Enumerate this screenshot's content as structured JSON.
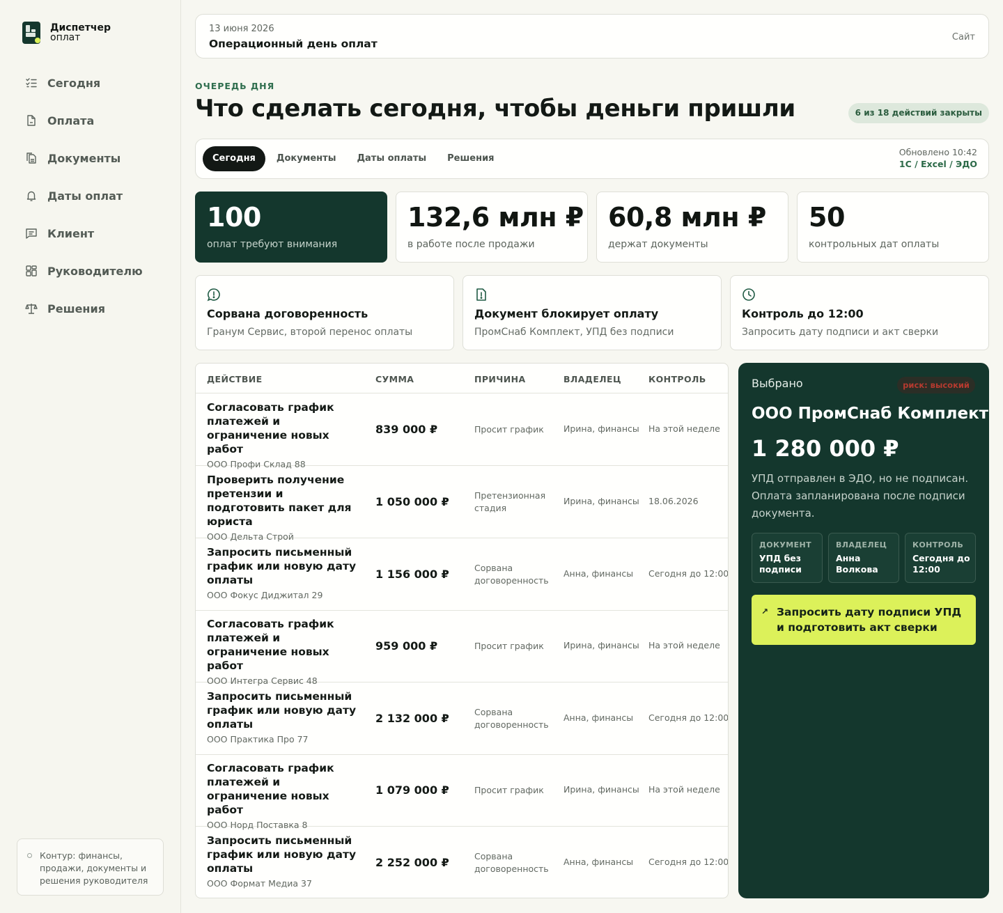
{
  "brand": {
    "name": "Диспетчер",
    "sub": "оплат"
  },
  "sidebar": {
    "items": [
      {
        "label": "Сегодня",
        "icon": "checklist-icon"
      },
      {
        "label": "Оплата",
        "icon": "document-icon"
      },
      {
        "label": "Документы",
        "icon": "documents-icon"
      },
      {
        "label": "Даты оплат",
        "icon": "bell-icon"
      },
      {
        "label": "Клиент",
        "icon": "message-icon"
      },
      {
        "label": "Руководителю",
        "icon": "dashboard-icon"
      },
      {
        "label": "Решения",
        "icon": "scales-icon"
      }
    ],
    "note": "Контур: финансы, продажи, документы и решения руководителя"
  },
  "topbar": {
    "date": "13 июня 2026",
    "title": "Операционный день оплат",
    "site": "Сайт"
  },
  "header": {
    "eyebrow": "ОЧЕРЕДЬ ДНЯ",
    "title": "Что сделать сегодня, чтобы деньги пришли",
    "progress": "6 из 18 действий закрыты"
  },
  "tabs": {
    "items": [
      "Сегодня",
      "Документы",
      "Даты оплаты",
      "Решения"
    ],
    "active": 0,
    "updated": "Обновлено 10:42",
    "sources": "1С / Excel / ЭДО"
  },
  "kpis": [
    {
      "value": "100",
      "label": "оплат требуют внимания"
    },
    {
      "value": "132,6 млн ₽",
      "label": "в работе после продажи"
    },
    {
      "value": "60,8 млн ₽",
      "label": "держат документы"
    },
    {
      "value": "50",
      "label": "контрольных дат оплаты"
    }
  ],
  "alerts": [
    {
      "icon": "alert-bubble-icon",
      "title": "Сорвана договоренность",
      "desc": "Гранум Сервис, второй перенос оплаты"
    },
    {
      "icon": "document-alert-icon",
      "title": "Документ блокирует оплату",
      "desc": "ПромСнаб Комплект, УПД без подписи"
    },
    {
      "icon": "clock-icon",
      "title": "Контроль до 12:00",
      "desc": "Запросить дату подписи и акт сверки"
    }
  ],
  "table": {
    "columns": [
      "ДЕЙСТВИЕ",
      "СУММА",
      "ПРИЧИНА",
      "ВЛАДЕЛЕЦ",
      "КОНТРОЛЬ"
    ],
    "rows": [
      {
        "action": "Согласовать график платежей и ограничение новых работ",
        "company": "ООО Профи Склад 88",
        "sum": "839 000 ₽",
        "reason": "Просит график",
        "owner": "Ирина, финансы",
        "control": "На этой неделе"
      },
      {
        "action": "Проверить получение претензии и подготовить пакет для юриста",
        "company": "ООО Дельта Строй",
        "sum": "1 050 000 ₽",
        "reason": "Претензионная стадия",
        "owner": "Ирина, финансы",
        "control": "18.06.2026"
      },
      {
        "action": "Запросить письменный график или новую дату оплаты",
        "company": "ООО Фокус Диджитал 29",
        "sum": "1 156 000 ₽",
        "reason": "Сорвана договоренность",
        "owner": "Анна, финансы",
        "control": "Сегодня до 12:00"
      },
      {
        "action": "Согласовать график платежей и ограничение новых работ",
        "company": "ООО Интегра Сервис 48",
        "sum": "959 000 ₽",
        "reason": "Просит график",
        "owner": "Ирина, финансы",
        "control": "На этой неделе"
      },
      {
        "action": "Запросить письменный график или новую дату оплаты",
        "company": "ООО Практика Про 77",
        "sum": "2 132 000 ₽",
        "reason": "Сорвана договоренность",
        "owner": "Анна, финансы",
        "control": "Сегодня до 12:00"
      },
      {
        "action": "Согласовать график платежей и ограничение новых работ",
        "company": "ООО Норд Поставка 8",
        "sum": "1 079 000 ₽",
        "reason": "Просит график",
        "owner": "Ирина, финансы",
        "control": "На этой неделе"
      },
      {
        "action": "Запросить письменный график или новую дату оплаты",
        "company": "ООО Формат Медиа 37",
        "sum": "2 252 000 ₽",
        "reason": "Сорвана договоренность",
        "owner": "Анна, финансы",
        "control": "Сегодня до 12:00"
      }
    ]
  },
  "detail": {
    "label": "Выбрано",
    "risk": "риск: высокий",
    "company": "ООО ПромСнаб Комплект",
    "amount": "1 280 000 ₽",
    "description": "УПД отправлен в ЭДО, но не подписан. Оплата запланирована после подписи документа.",
    "facts": [
      {
        "label": "ДОКУМЕНТ",
        "value": "УПД без подписи"
      },
      {
        "label": "ВЛАДЕЛЕЦ",
        "value": "Анна Волкова"
      },
      {
        "label": "КОНТРОЛЬ",
        "value": "Сегодня до 12:00"
      }
    ],
    "cta": "Запросить дату подписи УПД и подготовить акт сверки"
  },
  "colors": {
    "accent_dark": "#14372d",
    "cta": "#dcf15a",
    "risk": "#b53a2f",
    "progress_bg": "#dde8dc"
  }
}
